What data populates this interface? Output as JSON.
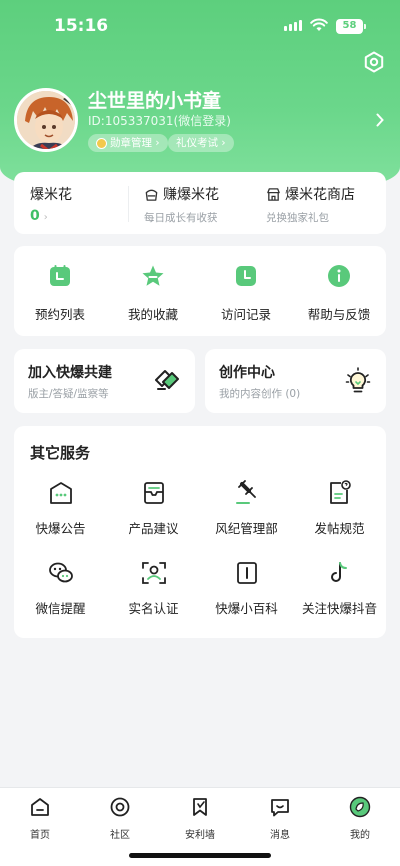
{
  "status": {
    "time": "15:16",
    "battery": "58"
  },
  "profile": {
    "name": "尘世里的小书童",
    "id_text": "ID:105337031(微信登录)",
    "chips": {
      "medal": "勋章管理 ›",
      "exam": "礼仪考试 ›"
    }
  },
  "popcorn": {
    "title": "爆米花",
    "value": "0",
    "earn": {
      "title": "赚爆米花",
      "subtitle": "每日成长有收获"
    },
    "shop": {
      "title": "爆米花商店",
      "subtitle": "兑换独家礼包"
    }
  },
  "quick_actions": [
    {
      "label": "预约列表",
      "icon": "calendar-icon"
    },
    {
      "label": "我的收藏",
      "icon": "star-icon"
    },
    {
      "label": "访问记录",
      "icon": "clock-icon"
    },
    {
      "label": "帮助与反馈",
      "icon": "info-icon"
    }
  ],
  "join": {
    "title": "加入快爆共建",
    "subtitle": "版主/答疑/监察等"
  },
  "create": {
    "title": "创作中心",
    "subtitle": "我的内容创作 (0)"
  },
  "services": {
    "title": "其它服务",
    "items": [
      {
        "label": "快爆公告",
        "icon": "announcement-icon"
      },
      {
        "label": "产品建议",
        "icon": "suggestion-icon"
      },
      {
        "label": "风纪管理部",
        "icon": "gavel-icon"
      },
      {
        "label": "发帖规范",
        "icon": "rules-icon"
      },
      {
        "label": "微信提醒",
        "icon": "wechat-icon"
      },
      {
        "label": "实名认证",
        "icon": "id-scan-icon"
      },
      {
        "label": "快爆小百科",
        "icon": "encyclopedia-icon"
      },
      {
        "label": "关注快爆抖音",
        "icon": "tiktok-icon"
      }
    ]
  },
  "tabs": [
    {
      "label": "首页",
      "icon": "home-icon"
    },
    {
      "label": "社区",
      "icon": "community-icon"
    },
    {
      "label": "安利墙",
      "icon": "bookmark-icon"
    },
    {
      "label": "消息",
      "icon": "message-icon"
    },
    {
      "label": "我的",
      "icon": "profile-icon",
      "active": true
    }
  ],
  "colors": {
    "brand": "#5dcf7d",
    "accent": "#3fbf67",
    "background": "#f3f4f6"
  }
}
